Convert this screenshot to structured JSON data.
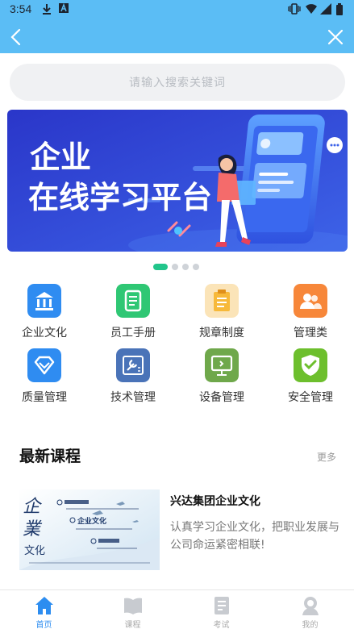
{
  "status_bar": {
    "time": "3:54"
  },
  "colors": {
    "header": "#5bbdf5",
    "accent": "#2d8df0",
    "dot_active": "#22c58b"
  },
  "search": {
    "placeholder": "请输入搜索关键词"
  },
  "banner": {
    "line1": "企业",
    "line2": "在线学习平台"
  },
  "carousel": {
    "count": 4,
    "active": 0
  },
  "categories": [
    {
      "label": "企业文化",
      "icon": "bank-icon",
      "color": "#2f8cf1"
    },
    {
      "label": "员工手册",
      "icon": "document-icon",
      "color": "#2fc774"
    },
    {
      "label": "规章制度",
      "icon": "clipboard-icon",
      "color": "#f7b93a"
    },
    {
      "label": "管理类",
      "icon": "users-icon",
      "color": "#f7873a"
    },
    {
      "label": "质量管理",
      "icon": "diamond-icon",
      "color": "#2f8cf1"
    },
    {
      "label": "技术管理",
      "icon": "tools-icon",
      "color": "#4a73b8"
    },
    {
      "label": "设备管理",
      "icon": "monitor-icon",
      "color": "#6fa84b"
    },
    {
      "label": "安全管理",
      "icon": "shield-check-icon",
      "color": "#6dbf2d"
    }
  ],
  "latest": {
    "title": "最新课程",
    "more": "更多",
    "courses": [
      {
        "title": "兴达集团企业文化",
        "desc": "认真学习企业文化，把职业发展与公司命运紧密相联!",
        "thumb_title": "企业文化"
      }
    ]
  },
  "tabs": [
    {
      "label": "首页",
      "icon": "home-icon",
      "active": true
    },
    {
      "label": "课程",
      "icon": "book-icon",
      "active": false
    },
    {
      "label": "考试",
      "icon": "exam-icon",
      "active": false
    },
    {
      "label": "我的",
      "icon": "user-icon",
      "active": false
    }
  ]
}
